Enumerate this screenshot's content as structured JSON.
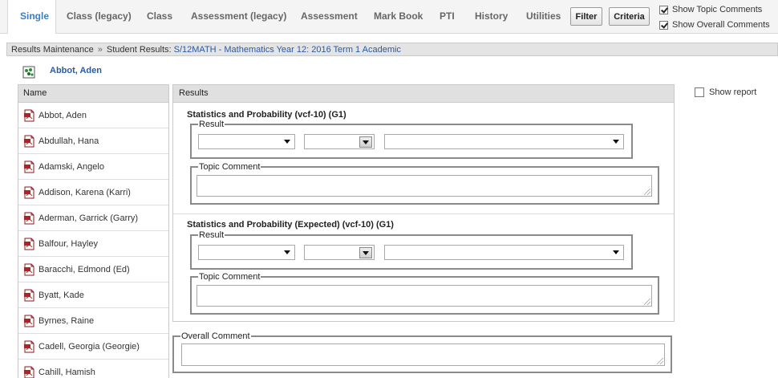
{
  "tabs": [
    {
      "label": "Single",
      "active": true
    },
    {
      "label": "Class (legacy)"
    },
    {
      "label": "Class"
    },
    {
      "label": "Assessment (legacy)"
    },
    {
      "label": "Assessment"
    },
    {
      "label": "Mark Book"
    },
    {
      "label": "PTI"
    },
    {
      "label": "History"
    },
    {
      "label": "Utilities"
    }
  ],
  "toolbar": {
    "filter_label": "Filter",
    "criteria_label": "Criteria"
  },
  "options": {
    "show_topic_comments": {
      "label": "Show Topic Comments",
      "checked": true
    },
    "show_overall_comments": {
      "label": "Show Overall Comments",
      "checked": true
    }
  },
  "breadcrumb": {
    "root": "Results Maintenance",
    "separator": "»",
    "current": "Student Results:",
    "link": "S/12MATH - Mathematics Year 12: 2016 Term 1 Academic"
  },
  "selected_student": "Abbot, Aden",
  "name_list": {
    "header": "Name",
    "items": [
      "Abbot, Aden",
      "Abdullah, Hana",
      "Adamski, Angelo",
      "Addison, Karena (Karri)",
      "Aderman, Garrick (Garry)",
      "Balfour, Hayley",
      "Baracchi, Edmond (Ed)",
      "Byatt, Kade",
      "Byrnes, Raine",
      "Cadell, Georgia (Georgie)",
      "Cahill, Hamish"
    ]
  },
  "results": {
    "header": "Results",
    "sections": [
      {
        "title": "Statistics and Probability  (vcf-10)  (G1)",
        "result_legend": "Result",
        "comment_legend": "Topic Comment"
      },
      {
        "title": "Statistics and Probability (Expected)  (vcf-10)  (G1)",
        "result_legend": "Result",
        "comment_legend": "Topic Comment"
      }
    ]
  },
  "overall_comment_legend": "Overall Comment",
  "show_report": {
    "label": "Show report",
    "checked": false
  },
  "colors": {
    "accent": "#3a7dc2",
    "link": "#2a5aa0"
  }
}
